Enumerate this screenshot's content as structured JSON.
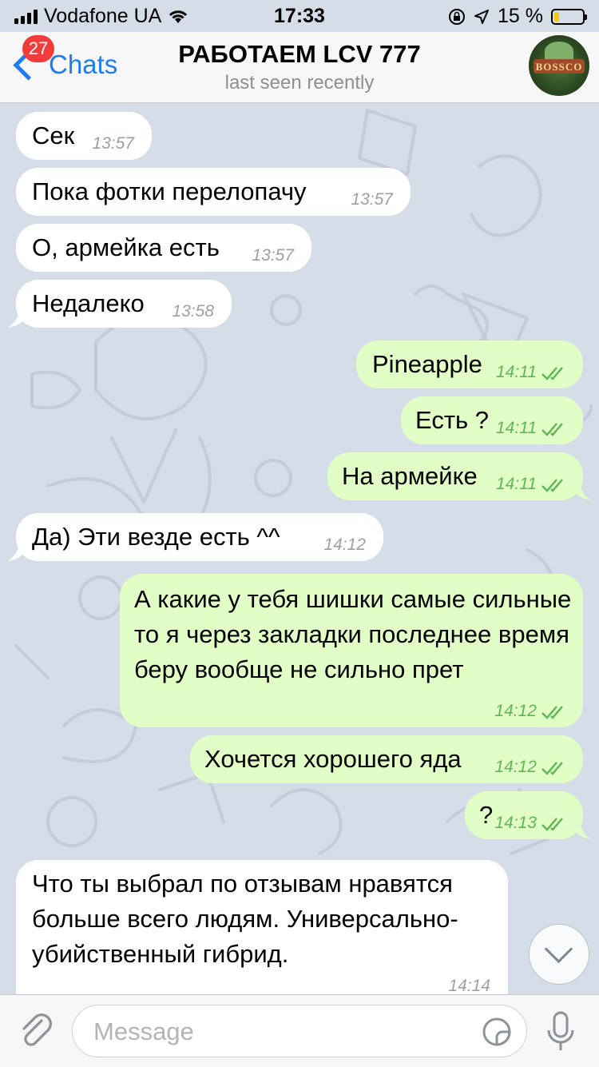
{
  "status_bar": {
    "carrier": "Vodafone UA",
    "time": "17:33",
    "battery_percent": "15 %",
    "battery_level": 0.15
  },
  "nav": {
    "back_label": "Chats",
    "unread_badge": "27",
    "title": "РАБОТАЕМ LCV 777",
    "subtitle": "last seen recently",
    "avatar_text": "BOSSCO"
  },
  "messages": [
    {
      "dir": "in",
      "text": "Сек",
      "time": "13:57"
    },
    {
      "dir": "in",
      "text": "Пока фотки перелопачу",
      "time": "13:57"
    },
    {
      "dir": "in",
      "text": "О, армейка есть",
      "time": "13:57"
    },
    {
      "dir": "in",
      "text": "Недалеко",
      "time": "13:58"
    },
    {
      "dir": "out",
      "text": "Pineapple",
      "time": "14:11"
    },
    {
      "dir": "out",
      "text": "Есть ?",
      "time": "14:11"
    },
    {
      "dir": "out",
      "text": "На армейке",
      "time": "14:11"
    },
    {
      "dir": "in",
      "text": "Да) Эти везде есть  ^^",
      "time": "14:12"
    },
    {
      "dir": "out",
      "text": "А какие у тебя шишки самые сильные то я через закладки последнее время беру вообще не сильно прет",
      "time": "14:12"
    },
    {
      "dir": "out",
      "text": "Хочется хорошего яда",
      "time": "14:12"
    },
    {
      "dir": "out",
      "text": "?",
      "time": "14:13"
    },
    {
      "dir": "in",
      "text": "Что ты выбрал по отзывам нравятся больше всего людям. Универсально-убийственный гибрид.",
      "time": "14:14"
    }
  ],
  "input": {
    "placeholder": "Message"
  },
  "colors": {
    "accent": "#1f7cf0",
    "outgoing_bubble": "#e1fec7",
    "incoming_bubble": "#ffffff",
    "read_ticks": "#5fb556",
    "badge": "#f23c3c"
  }
}
